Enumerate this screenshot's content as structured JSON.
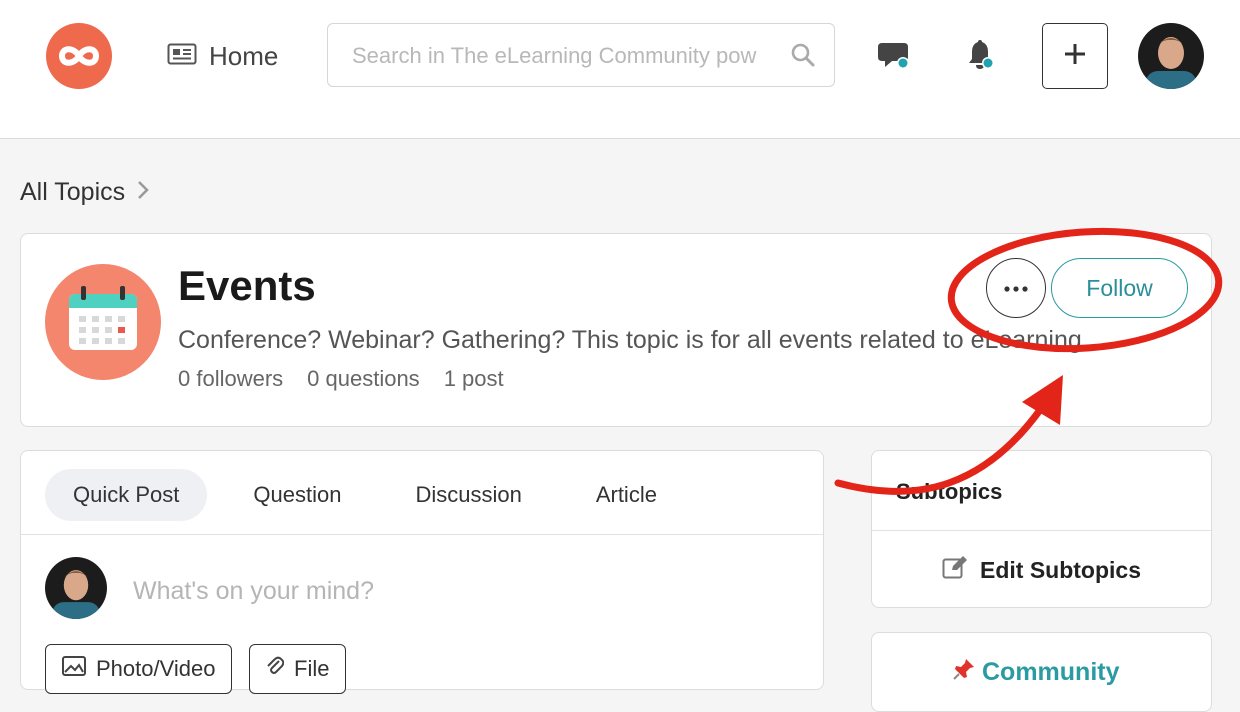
{
  "header": {
    "home_label": "Home",
    "search_placeholder": "Search in The eLearning Community pow"
  },
  "breadcrumb": {
    "label": "All Topics"
  },
  "topic": {
    "title": "Events",
    "description": "Conference? Webinar? Gathering? This topic is for all events related to eLearning",
    "followers": "0 followers",
    "questions": "0 questions",
    "posts": "1 post",
    "follow_label": "Follow"
  },
  "composer": {
    "tabs": [
      "Quick Post",
      "Question",
      "Discussion",
      "Article"
    ],
    "placeholder": "What's on your mind?",
    "photo_label": "Photo/Video",
    "file_label": "File"
  },
  "subtopics": {
    "title": "Subtopics",
    "edit_label": "Edit Subtopics"
  },
  "community": {
    "label": "Community"
  },
  "colors": {
    "brand": "#ef6a4d",
    "accent": "#2a9aa3",
    "annotation": "#e32418",
    "notification_dot": "#1fa3b0"
  },
  "icons": {
    "logo": "infinity-logo-icon",
    "home": "newspaper-icon",
    "search": "search-icon",
    "chat": "chat-icon",
    "bell": "bell-icon",
    "plus": "plus-icon",
    "more": "ellipsis-icon",
    "edit": "edit-icon",
    "pin": "pushpin-icon"
  }
}
